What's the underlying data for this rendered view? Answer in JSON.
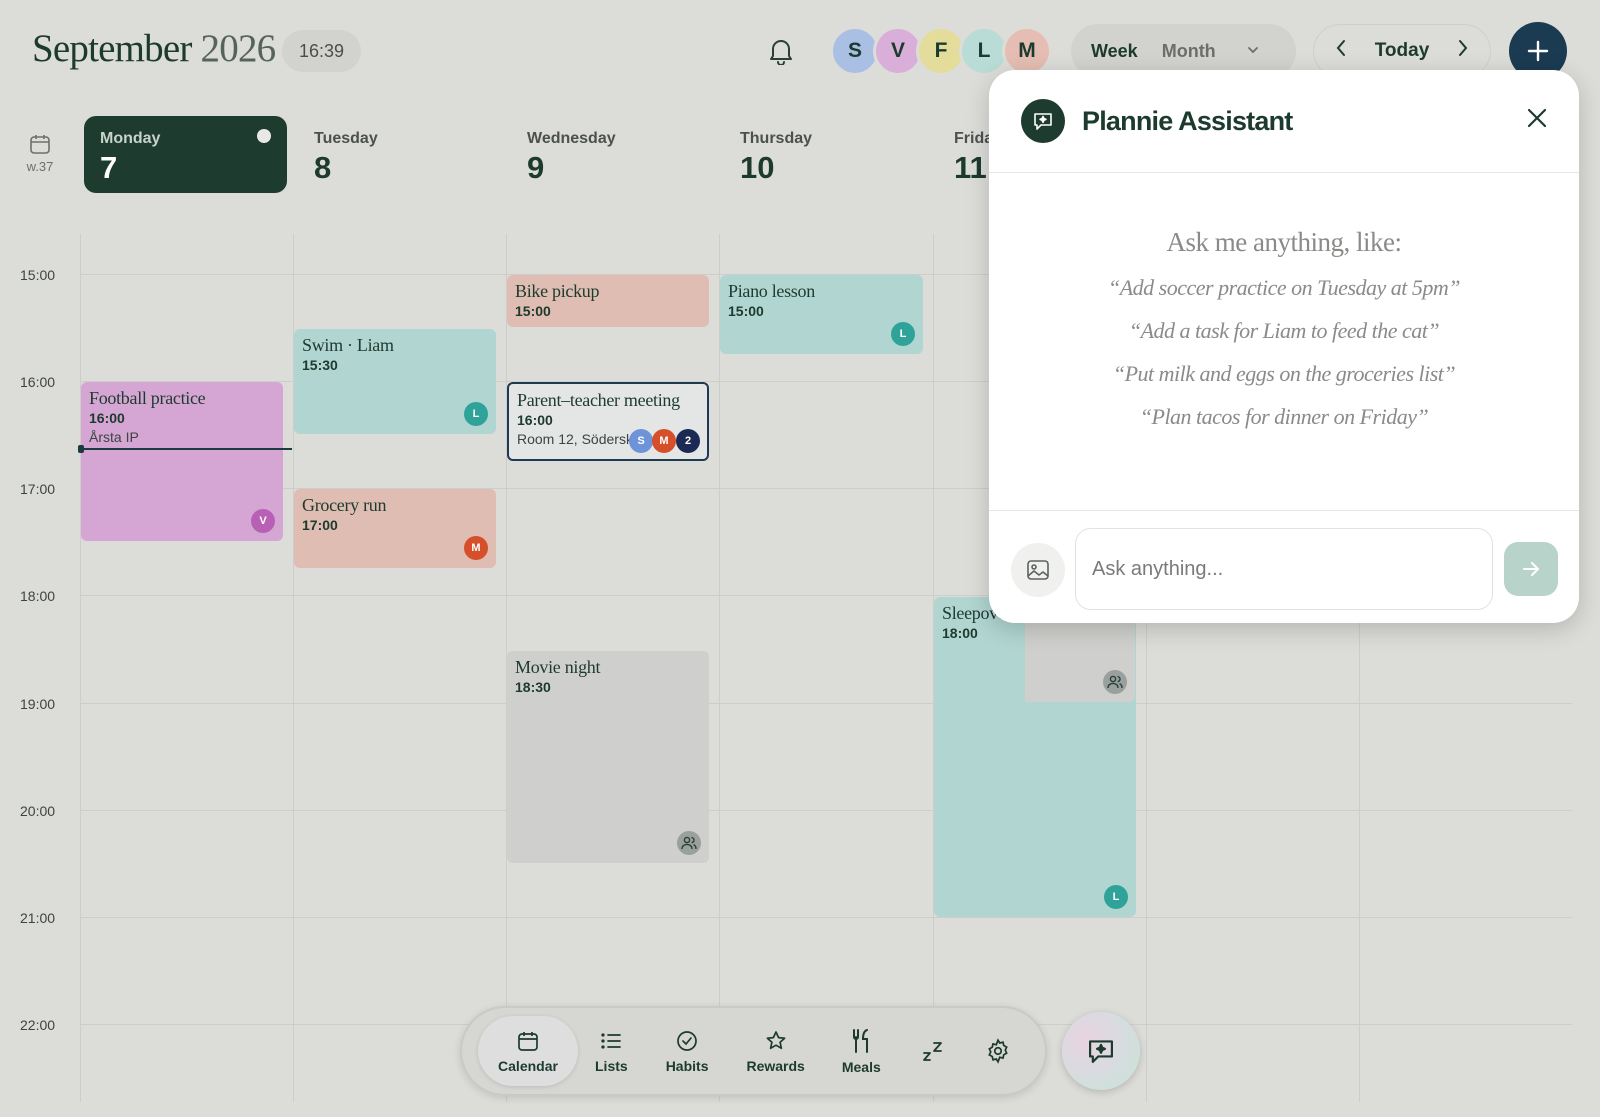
{
  "header": {
    "month": "September",
    "year": "2026",
    "time": "16:39",
    "avatars": [
      {
        "initial": "S",
        "color": "#a9bfe3"
      },
      {
        "initial": "V",
        "color": "#d9aed8"
      },
      {
        "initial": "F",
        "color": "#e3dc9a"
      },
      {
        "initial": "L",
        "color": "#b9dcd6"
      },
      {
        "initial": "M",
        "color": "#e5bdb2"
      }
    ],
    "view_week": "Week",
    "view_month": "Month",
    "today_label": "Today"
  },
  "week_label": "w.37",
  "days": [
    {
      "name": "Monday",
      "num": "7"
    },
    {
      "name": "Tuesday",
      "num": "8"
    },
    {
      "name": "Wednesday",
      "num": "9"
    },
    {
      "name": "Thursday",
      "num": "10"
    },
    {
      "name": "Friday",
      "num": "11"
    }
  ],
  "hours": [
    "15:00",
    "16:00",
    "17:00",
    "18:00",
    "19:00",
    "20:00",
    "21:00",
    "22:00"
  ],
  "events": {
    "football": {
      "title": "Football practice",
      "time": "16:00",
      "location": "Årsta IP",
      "badge": "V"
    },
    "swim": {
      "title": "Swim · Liam",
      "time": "15:30",
      "badge": "L"
    },
    "grocery": {
      "title": "Grocery run",
      "time": "17:00",
      "badge": "M"
    },
    "bike": {
      "title": "Bike pickup",
      "time": "15:00"
    },
    "ptm": {
      "title": "Parent–teacher meeting",
      "time": "16:00",
      "location": "Room 12, Södersk",
      "badges": [
        "S",
        "M",
        "2"
      ]
    },
    "movie": {
      "title": "Movie night",
      "time": "18:30"
    },
    "piano": {
      "title": "Piano lesson",
      "time": "15:00",
      "badge": "L"
    },
    "sleepover": {
      "title": "Sleepove",
      "time": "18:00",
      "badge": "L"
    }
  },
  "colors": {
    "accent": "#1d3b2e",
    "add_button": "#1b3b52",
    "badge_v": "#b860b6",
    "badge_l": "#2fa39a",
    "badge_m": "#d5502a",
    "badge_s": "#6f93d8",
    "badge_count": "#1b2a55"
  },
  "assistant": {
    "title": "Plannie Assistant",
    "prompt": "Ask me anything, like:",
    "examples": [
      "“Add soccer practice on Tuesday at 5pm”",
      "“Add a task for Liam to feed the cat”",
      "“Put milk and eggs on the groceries list”",
      "“Plan tacos for dinner on Friday”"
    ],
    "input_placeholder": "Ask anything..."
  },
  "nav": [
    {
      "label": "Calendar",
      "icon": "calendar-icon"
    },
    {
      "label": "Lists",
      "icon": "list-icon"
    },
    {
      "label": "Habits",
      "icon": "check-circle-icon"
    },
    {
      "label": "Rewards",
      "icon": "star-icon"
    },
    {
      "label": "Meals",
      "icon": "utensils-icon"
    },
    {
      "label": "",
      "icon": "sleep-icon"
    },
    {
      "label": "",
      "icon": "gear-icon"
    }
  ]
}
